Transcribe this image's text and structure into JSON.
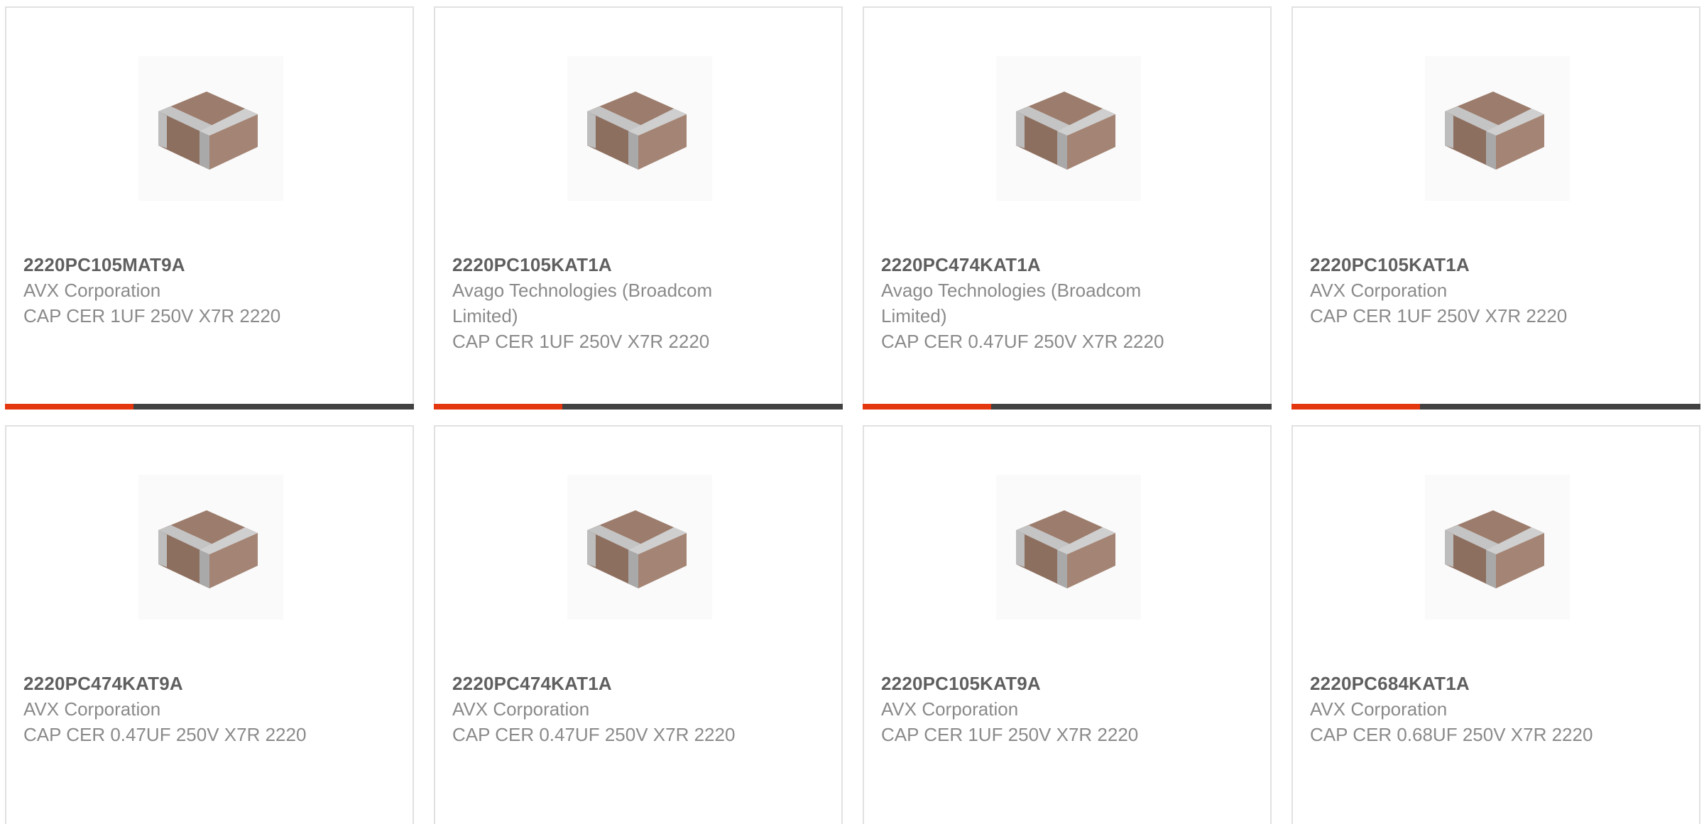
{
  "colors": {
    "accent": "#e5370f",
    "bar_track": "#424242",
    "part_text": "#5f5f5f",
    "body_text": "#8a8a8a",
    "border": "#e1e1e1"
  },
  "products": [
    {
      "part": "2220PC105MAT9A",
      "manufacturer": "AVX Corporation",
      "description": "CAP CER 1UF 250V X7R 2220",
      "image_icon": "ceramic-capacitor-chip-icon",
      "bar_fill": 0.315
    },
    {
      "part": "2220PC105KAT1A",
      "manufacturer": "Avago Technologies (Broadcom Limited)",
      "description": "CAP CER 1UF 250V X7R 2220",
      "image_icon": "ceramic-capacitor-chip-icon",
      "bar_fill": 0.315
    },
    {
      "part": "2220PC474KAT1A",
      "manufacturer": "Avago Technologies (Broadcom Limited)",
      "description": "CAP CER 0.47UF 250V X7R 2220",
      "image_icon": "ceramic-capacitor-chip-icon",
      "bar_fill": 0.315
    },
    {
      "part": "2220PC105KAT1A",
      "manufacturer": "AVX Corporation",
      "description": "CAP CER 1UF 250V X7R 2220",
      "image_icon": "ceramic-capacitor-chip-icon",
      "bar_fill": 0.315
    },
    {
      "part": "2220PC474KAT9A",
      "manufacturer": "AVX Corporation",
      "description": "CAP CER 0.47UF 250V X7R 2220",
      "image_icon": "ceramic-capacitor-chip-icon"
    },
    {
      "part": "2220PC474KAT1A",
      "manufacturer": "AVX Corporation",
      "description": "CAP CER 0.47UF 250V X7R 2220",
      "image_icon": "ceramic-capacitor-chip-icon"
    },
    {
      "part": "2220PC105KAT9A",
      "manufacturer": "AVX Corporation",
      "description": "CAP CER 1UF 250V X7R 2220",
      "image_icon": "ceramic-capacitor-chip-icon"
    },
    {
      "part": "2220PC684KAT1A",
      "manufacturer": "AVX Corporation",
      "description": "CAP CER 0.68UF 250V X7R 2220",
      "image_icon": "ceramic-capacitor-chip-icon"
    }
  ]
}
